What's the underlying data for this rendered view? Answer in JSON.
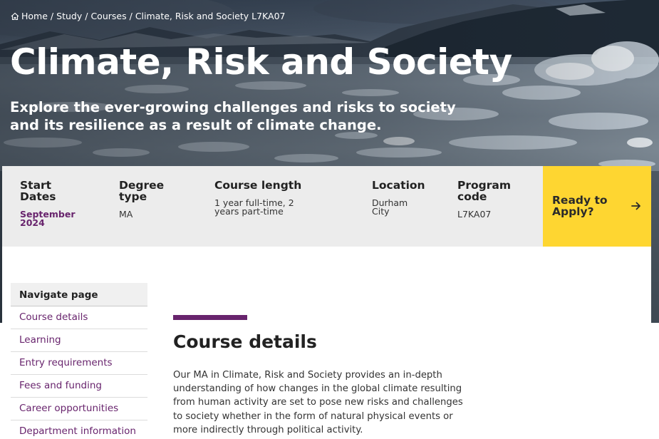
{
  "breadcrumb": {
    "items": [
      "Home",
      "Study",
      "Courses",
      "Climate, Risk and Society L7KA07"
    ],
    "separator": "/"
  },
  "hero": {
    "title": "Climate, Risk and Society",
    "subtitle": "Explore the ever-growing challenges and risks to society and its resilience as a result of climate change."
  },
  "course_info": [
    {
      "label": "Start Dates",
      "value": "September 2024",
      "highlight": true
    },
    {
      "label": "Degree type",
      "value": "MA",
      "highlight": false
    },
    {
      "label": "Course length",
      "value": "1 year full-time, 2 years part-time",
      "highlight": false
    },
    {
      "label": "Location",
      "value": "Durham City",
      "highlight": false
    },
    {
      "label": "Program code",
      "value": "L7KA07",
      "highlight": false
    }
  ],
  "apply": {
    "label": "Ready to Apply?",
    "icon": "arrow-right-icon"
  },
  "sidenav": {
    "heading": "Navigate page",
    "items": [
      "Course details",
      "Learning",
      "Entry requirements",
      "Fees and funding",
      "Career opportunities",
      "Department information"
    ]
  },
  "section": {
    "title": "Course details",
    "body": "Our MA in Climate, Risk and Society provides an in-depth understanding of how changes in the global climate resulting from human activity are set to pose new risks and challenges to society whether in the form of natural physical events or more indirectly through political activity."
  },
  "colors": {
    "accent": "#68246d",
    "apply_background": "#fed631",
    "infobar_background": "#ececec"
  }
}
